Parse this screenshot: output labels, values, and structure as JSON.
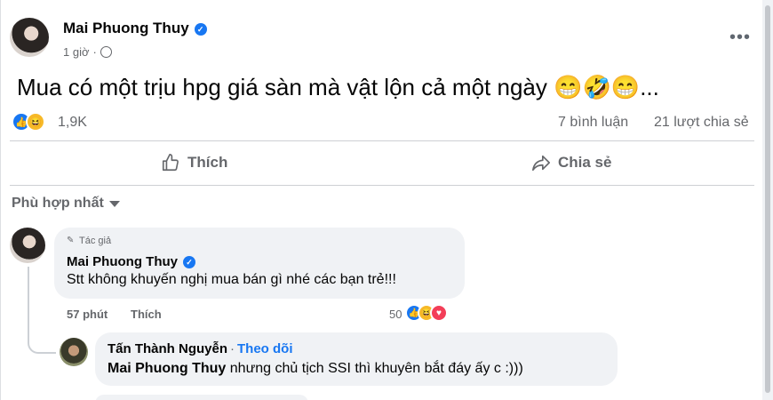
{
  "post": {
    "author": "Mai Phuong Thuy",
    "time": "1 giờ",
    "text": "Mua có một trịu hpg giá sàn mà vật lộn cả một ngày 😁🤣😁...",
    "reaction_count": "1,9K",
    "comment_count": "7 bình luận",
    "share_count": "21 lượt chia sẻ",
    "reaction_icons": [
      "like-icon",
      "haha-icon"
    ],
    "more_icon": "more-options-icon"
  },
  "actions": {
    "like_label": "Thích",
    "share_label": "Chia sẻ"
  },
  "comments": {
    "sort_label": "Phù hợp nhất",
    "items": [
      {
        "author_tag": "Tác giả",
        "author": "Mai Phuong Thuy",
        "text": "Stt không khuyến nghị mua bán gì nhé các bạn trẻ!!!",
        "time": "57 phút",
        "like_label": "Thích",
        "reaction_count": "50",
        "reaction_icons": [
          "like-icon",
          "haha-icon",
          "love-icon"
        ]
      }
    ],
    "replies": [
      {
        "author": "Tấn Thành Nguyễn",
        "follow_label": "Theo dõi",
        "mention": "Mai Phuong Thuy",
        "text": " nhưng chủ tịch SSI thì khuyên bắt đáy ấy c :)))"
      }
    ]
  },
  "colors": {
    "accent": "#1877f2",
    "secondary_text": "#65676b",
    "bubble": "#f0f2f5"
  }
}
